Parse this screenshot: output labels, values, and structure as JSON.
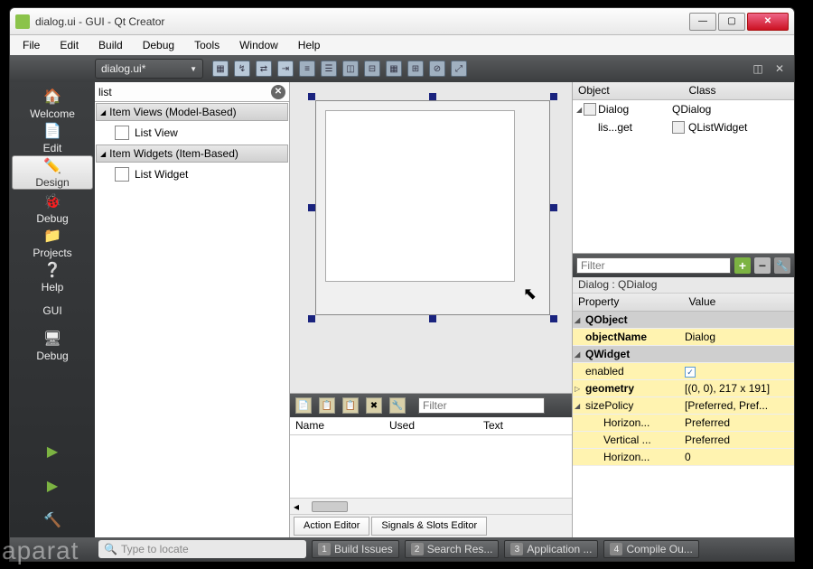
{
  "window": {
    "title": "dialog.ui - GUI - Qt Creator"
  },
  "menu": [
    "File",
    "Edit",
    "Build",
    "Debug",
    "Tools",
    "Window",
    "Help"
  ],
  "filetab": "dialog.ui*",
  "sidebar": [
    {
      "label": "Welcome"
    },
    {
      "label": "Edit"
    },
    {
      "label": "Design"
    },
    {
      "label": "Debug"
    },
    {
      "label": "Projects"
    },
    {
      "label": "Help"
    },
    {
      "label": "GUI"
    },
    {
      "label": "Debug"
    }
  ],
  "widgetbox": {
    "search": "list",
    "cat1": "Item Views (Model-Based)",
    "item1": "List View",
    "cat2": "Item Widgets (Item-Based)",
    "item2": "List Widget"
  },
  "actionpanel": {
    "filter_ph": "Filter",
    "cols": {
      "name": "Name",
      "used": "Used",
      "text": "Text"
    },
    "tab1": "Action Editor",
    "tab2": "Signals & Slots Editor"
  },
  "objecttree": {
    "col1": "Object",
    "col2": "Class",
    "r1o": "Dialog",
    "r1c": "QDialog",
    "r2o": "lis...get",
    "r2c": "QListWidget"
  },
  "propfilter_ph": "Filter",
  "propcontext": "Dialog : QDialog",
  "prophead": {
    "c1": "Property",
    "c2": "Value"
  },
  "props": {
    "g1": "QObject",
    "objectName_k": "objectName",
    "objectName_v": "Dialog",
    "g2": "QWidget",
    "enabled_k": "enabled",
    "geometry_k": "geometry",
    "geometry_v": "[(0, 0), 217 x 191]",
    "sizePolicy_k": "sizePolicy",
    "sizePolicy_v": "[Preferred, Pref...",
    "horiz_k": "Horizon...",
    "horiz_v": "Preferred",
    "vert_k": "Vertical ...",
    "vert_v": "Preferred",
    "horiz2_k": "Horizon...",
    "horiz2_v": "0"
  },
  "status": {
    "locate_ph": "Type to locate",
    "b1": "Build Issues",
    "b2": "Search Res...",
    "b3": "Application ...",
    "b4": "Compile Ou..."
  },
  "watermark": "aparat"
}
